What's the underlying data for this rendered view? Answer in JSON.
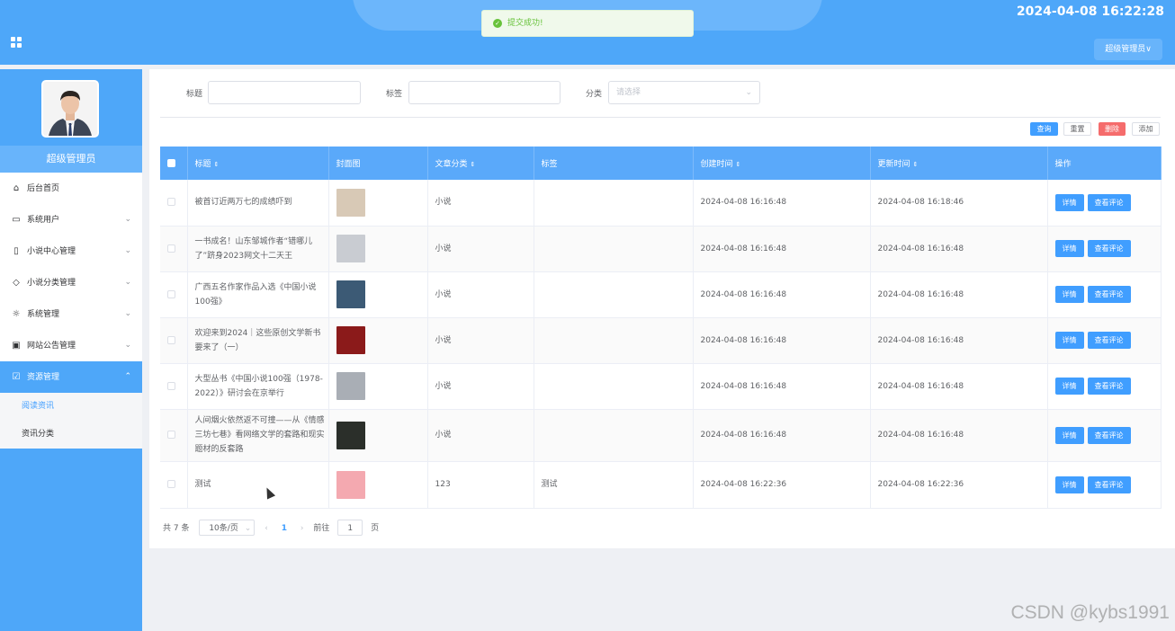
{
  "header": {
    "datetime": "2024-04-08 16:22:28",
    "user_button": "超级管理员∨",
    "menu_icon": "grid-icon"
  },
  "toast": {
    "message": "提交成功!",
    "icon": "check-circle-icon"
  },
  "sidebar": {
    "role": "超级管理员",
    "items": [
      {
        "label": "后台首页",
        "icon": "home-icon"
      },
      {
        "label": "系统用户",
        "icon": "monitor-icon"
      },
      {
        "label": "小说中心管理",
        "icon": "bookmark-icon"
      },
      {
        "label": "小说分类管理",
        "icon": "tag-icon"
      },
      {
        "label": "系统管理",
        "icon": "sun-icon"
      },
      {
        "label": "网站公告管理",
        "icon": "inbox-icon"
      },
      {
        "label": "资源管理",
        "icon": "clipboard-icon"
      }
    ],
    "subitems": [
      {
        "label": "阅读资讯"
      },
      {
        "label": "资讯分类"
      }
    ]
  },
  "search": {
    "title_label": "标题",
    "tag_label": "标签",
    "category_label": "分类",
    "category_placeholder": "请选择"
  },
  "actions": {
    "query": "查询",
    "reset": "重置",
    "delete": "删除",
    "add": "添加"
  },
  "table": {
    "columns": [
      "标题",
      "封面图",
      "文章分类",
      "标签",
      "创建时间",
      "更新时间",
      "操作"
    ],
    "detail_label": "详情",
    "comment_label": "查看评论",
    "rows": [
      {
        "title": "被首订近两万七的成绩吓到",
        "category": "小说",
        "tag": "",
        "created": "2024-04-08 16:16:48",
        "updated": "2024-04-08 16:18:46",
        "cover_color": "#d8c9b6"
      },
      {
        "title": "一书成名！山东邹城作者“错哪儿了”跻身2023网文十二天王",
        "category": "小说",
        "tag": "",
        "created": "2024-04-08 16:16:48",
        "updated": "2024-04-08 16:16:48",
        "cover_color": "#c9ccd2"
      },
      {
        "title": "广西五名作家作品入选《中国小说100强》",
        "category": "小说",
        "tag": "",
        "created": "2024-04-08 16:16:48",
        "updated": "2024-04-08 16:16:48",
        "cover_color": "#3c5a75"
      },
      {
        "title": "欢迎来到2024｜这些原创文学新书要来了（一）",
        "category": "小说",
        "tag": "",
        "created": "2024-04-08 16:16:48",
        "updated": "2024-04-08 16:16:48",
        "cover_color": "#8b1a1a"
      },
      {
        "title": "大型丛书《中国小说100强（1978-2022）》研讨会在京举行",
        "category": "小说",
        "tag": "",
        "created": "2024-04-08 16:16:48",
        "updated": "2024-04-08 16:16:48",
        "cover_color": "#a9aeb5"
      },
      {
        "title": "人间烟火依然返不可撞——从《情感三坊七巷》看网络文学的套路和现实题材的反套路",
        "category": "小说",
        "tag": "",
        "created": "2024-04-08 16:16:48",
        "updated": "2024-04-08 16:16:48",
        "cover_color": "#2b2f2a"
      },
      {
        "title": "测试",
        "category": "123",
        "tag": "测试",
        "created": "2024-04-08 16:22:36",
        "updated": "2024-04-08 16:22:36",
        "cover_color": "#f4a9b0"
      }
    ]
  },
  "pager": {
    "total": "共 7 条",
    "page_size": "10条/页",
    "current_page": "1",
    "goto_label": "前往",
    "goto_value": "1",
    "page_unit": "页"
  },
  "watermark": "CSDN @kybs1991"
}
